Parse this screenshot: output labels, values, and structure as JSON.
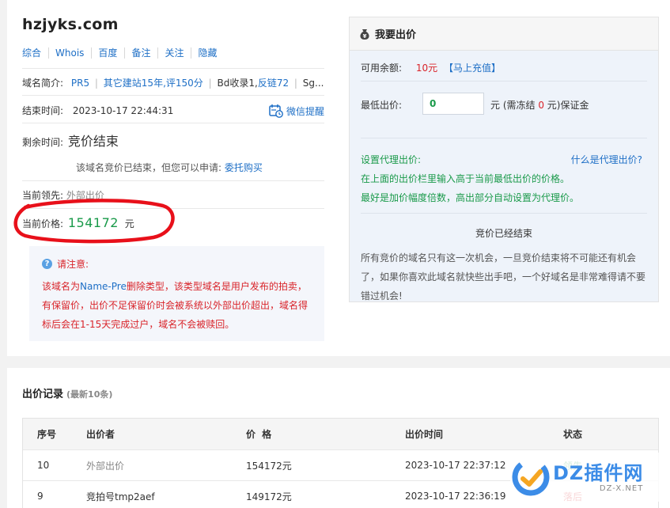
{
  "domain": "hzjyks.com",
  "tabs": [
    "综合",
    "Whois",
    "百度",
    "备注",
    "关注",
    "隐藏"
  ],
  "intro": {
    "label": "域名简介:",
    "pr": "PR5",
    "other_sites": "其它建站15年,评150分",
    "bd": "Bd收录1,",
    "backlinks": "反链72",
    "more": "Sg..."
  },
  "end_time": {
    "label": "结束时间:",
    "value": "2023-10-17 22:44:31",
    "wechat": "微信提醒"
  },
  "remaining": {
    "label": "剩余时间:",
    "value": "竞价结束"
  },
  "ended_hint": {
    "text": "该域名竞价已结束，但您可以申请:",
    "link": "委托购买"
  },
  "leader": {
    "label": "当前领先:",
    "value": "外部出价"
  },
  "current_price": {
    "label": "当前价格:",
    "value": "154172",
    "unit": "元"
  },
  "notice": {
    "title": "请注意:",
    "line1_pre": "该域名为",
    "line1_link": "Name-Pre",
    "line1_post": "删除类型，该类型域名是用户发布的拍卖，",
    "line2": "有保留价，出价不足保留价时会被系统以外部出价超出，域名得",
    "line3": "标后会在1-15天完成过户，域名不会被赎回。"
  },
  "bid_panel": {
    "title": "我要出价",
    "balance_label": "可用余额:",
    "balance_value": "10元",
    "recharge": "【马上充值】",
    "min_bid_label": "最低出价:",
    "min_bid_value": "0",
    "deposit_pre": "元 (需冻结",
    "deposit_value": "0",
    "deposit_post": "元)保证金",
    "proxy_label": "设置代理出价:",
    "proxy_help": "什么是代理出价?",
    "proxy_line1": "在上面的出价栏里输入高于当前最低出价的价格。",
    "proxy_line2": "最好是加价幅度倍数，高出部分自动设置为代理价。",
    "ended_title": "竞价已经结束",
    "ended_line1": "所有竞价的域名只有这一次机会，一旦竞价结束将不可能还有机会",
    "ended_line2": "了，如果你喜欢此域名就快些出手吧，一个好域名是非常难得请不要",
    "ended_line3": "错过机会!"
  },
  "records": {
    "title": "出价记录",
    "subtitle": "(最新10条)",
    "headers": [
      "序号",
      "出价者",
      "价 格",
      "出价时间",
      "状态"
    ],
    "rows": [
      {
        "no": "10",
        "bidder": "外部出价",
        "price": "154172元",
        "time": "2023-10-17 22:37:12",
        "status": "领先"
      },
      {
        "no": "9",
        "bidder": "竞拍号tmp2aef",
        "price": "149172元",
        "time": "2023-10-17 22:36:19",
        "status": "落后"
      }
    ]
  },
  "watermark": {
    "main": "DZ插件网",
    "sub": "DZ-X.NET"
  },
  "colors": {
    "link": "#1e6fc6",
    "price_green": "#1a9a4a",
    "alert_red": "#d9242a",
    "panel_bg": "#eef3fa"
  }
}
